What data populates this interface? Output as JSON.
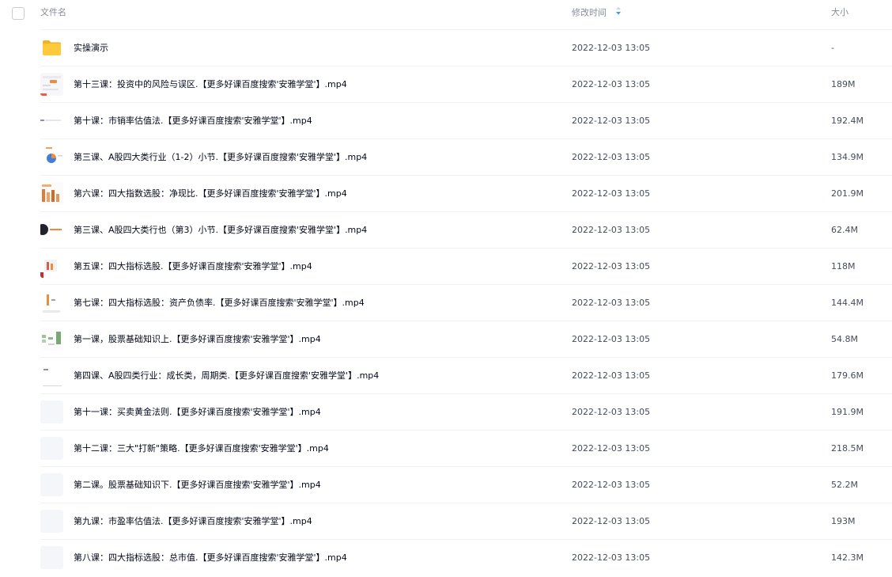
{
  "header": {
    "name_label": "文件名",
    "time_label": "修改时间",
    "size_label": "大小"
  },
  "colors": {
    "folder": "#ffc93c",
    "sort_accent": "#2f9bf5",
    "header_text": "#878c9c",
    "row_divider": "#f1f2f4"
  },
  "files": [
    {
      "name": "实操演示",
      "time": "2022-12-03 13:05",
      "size": "-",
      "icon": "folder-icon"
    },
    {
      "name": "第十三课：投资中的风险与误区.【更多好课百度搜索'安雅学堂'】.mp4",
      "time": "2022-12-03 13:05",
      "size": "189M",
      "icon": "video-thumbnail"
    },
    {
      "name": "第十课：市销率估值法.【更多好课百度搜索'安雅学堂'】.mp4",
      "time": "2022-12-03 13:05",
      "size": "192.4M",
      "icon": "video-thumbnail"
    },
    {
      "name": "第三课、A股四大类行业（1-2）小节.【更多好课百度搜索'安雅学堂'】.mp4",
      "time": "2022-12-03 13:05",
      "size": "134.9M",
      "icon": "video-thumbnail"
    },
    {
      "name": "第六课：四大指数选股：净现比.【更多好课百度搜索'安雅学堂'】.mp4",
      "time": "2022-12-03 13:05",
      "size": "201.9M",
      "icon": "video-thumbnail"
    },
    {
      "name": "第三课、A股四大类行也（第3）小节.【更多好课百度搜索'安雅学堂'】.mp4",
      "time": "2022-12-03 13:05",
      "size": "62.4M",
      "icon": "video-thumbnail"
    },
    {
      "name": "第五课：四大指标选股.【更多好课百度搜索'安雅学堂'】.mp4",
      "time": "2022-12-03 13:05",
      "size": "118M",
      "icon": "video-thumbnail"
    },
    {
      "name": "第七课：四大指标选股：资产负债率.【更多好课百度搜索'安雅学堂'】.mp4",
      "time": "2022-12-03 13:05",
      "size": "144.4M",
      "icon": "video-thumbnail"
    },
    {
      "name": "第一课，股票基础知识上.【更多好课百度搜索'安雅学堂'】.mp4",
      "time": "2022-12-03 13:05",
      "size": "54.8M",
      "icon": "video-thumbnail"
    },
    {
      "name": "第四课、A股四类行业：成长类，周期类.【更多好课百度搜索'安雅学堂'】.mp4",
      "time": "2022-12-03 13:05",
      "size": "179.6M",
      "icon": "video-thumbnail"
    },
    {
      "name": "第十一课：买卖黄金法则.【更多好课百度搜索'安雅学堂'】.mp4",
      "time": "2022-12-03 13:05",
      "size": "191.9M",
      "icon": "video-thumbnail"
    },
    {
      "name": "第十二课：三大\"打新\"策略.【更多好课百度搜索'安雅学堂'】.mp4",
      "time": "2022-12-03 13:05",
      "size": "218.5M",
      "icon": "video-thumbnail"
    },
    {
      "name": "第二课。股票基础知识下.【更多好课百度搜索'安雅学堂'】.mp4",
      "time": "2022-12-03 13:05",
      "size": "52.2M",
      "icon": "video-thumbnail"
    },
    {
      "name": "第九课：市盈率估值法.【更多好课百度搜索'安雅学堂'】.mp4",
      "time": "2022-12-03 13:05",
      "size": "193M",
      "icon": "video-thumbnail"
    },
    {
      "name": "第八课：四大指标选股：总市值.【更多好课百度搜索'安雅学堂'】.mp4",
      "time": "2022-12-03 13:05",
      "size": "142.3M",
      "icon": "video-thumbnail"
    }
  ]
}
